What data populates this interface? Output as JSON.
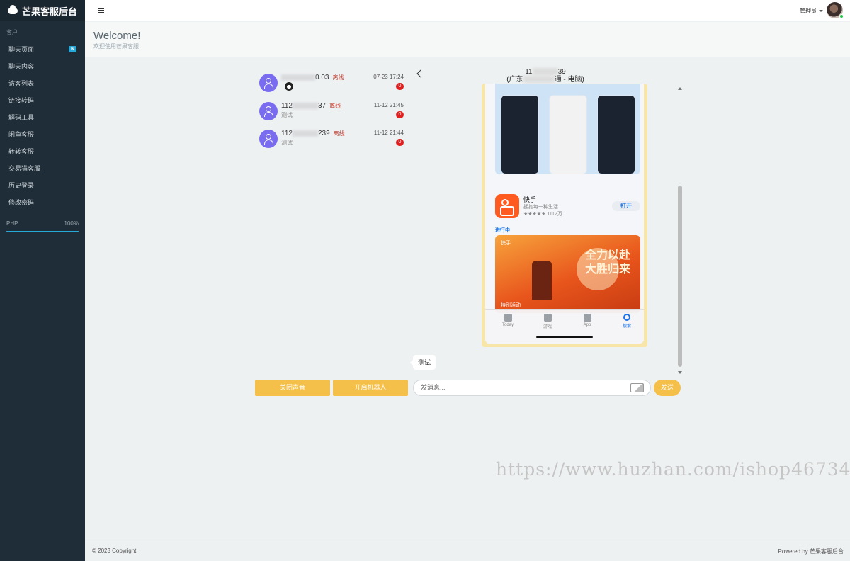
{
  "brand": {
    "title": "芒果客服后台",
    "icon": "cloud-icon"
  },
  "sidebar": {
    "section_label": "客户",
    "items": [
      {
        "label": "聊天页面",
        "badge": "N"
      },
      {
        "label": "聊天内容"
      },
      {
        "label": "访客列表"
      },
      {
        "label": "链接转码"
      },
      {
        "label": "解码工具"
      },
      {
        "label": "闲鱼客服"
      },
      {
        "label": "转转客服"
      },
      {
        "label": "交易猫客服"
      },
      {
        "label": "历史登录"
      },
      {
        "label": "修改密码"
      }
    ],
    "progress": {
      "label": "PHP",
      "value_text": "100%",
      "value": 1.0
    }
  },
  "topbar": {
    "user_label": "管理员",
    "menu_icon": "menu-toggle-icon"
  },
  "header": {
    "title": "Welcome!",
    "subtitle": "欢迎使用芒果客服"
  },
  "contacts": [
    {
      "name_prefix": "",
      "name_suffix": "0.03",
      "status": "离线",
      "message": "",
      "time": "07-23 17:24",
      "unread": "0",
      "has_qq_icon": true
    },
    {
      "name_prefix": "112",
      "name_suffix": "37",
      "status": "离线",
      "message": "测试",
      "time": "11-12 21:45",
      "unread": "0"
    },
    {
      "name_prefix": "112",
      "name_suffix": "239",
      "status": "离线",
      "message": "测试",
      "time": "11-12 21:44",
      "unread": "0"
    }
  ],
  "chat": {
    "title_prefix": "11",
    "title_suffix": "39",
    "subtitle_prefix": "(广东",
    "subtitle_suffix": "通 - 电脑)",
    "screenshot": {
      "app_name": "快手",
      "app_desc": "拥抱每一种生活",
      "app_rating": "★★★★★ 1112万",
      "open_label": "打开",
      "section_tag": "进行中",
      "banner_slogan_1": "全力以赴",
      "banner_slogan_2": "大胜归来",
      "banner_tag_top": "快手",
      "banner_tag_bottom": "特别活动",
      "tabs": [
        "Today",
        "游戏",
        "App",
        "搜索"
      ]
    },
    "text_message": "测试"
  },
  "controls": {
    "mute_label": "关闭声音",
    "robot_label": "开启机器人",
    "input_placeholder": "发消息...",
    "send_label": "发送"
  },
  "watermark": "https://www.huzhan.com/ishop46734",
  "footer": {
    "copyright": "© 2023 Copyright.",
    "powered": "Powered by 芒果客服后台"
  },
  "colors": {
    "sidebar": "#1f2d38",
    "accent": "#f5c04a",
    "avatar": "#7a6cf0",
    "badge": "#27a9d8",
    "unread": "#e02020"
  }
}
